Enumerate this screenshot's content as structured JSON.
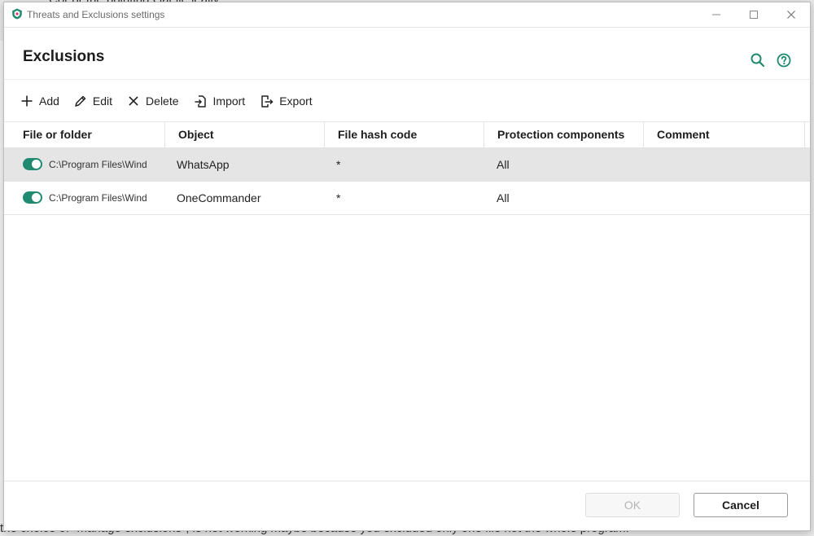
{
  "background": {
    "top_text": "Cor or the pointing Gaelle leally",
    "bottom_text": "the choice of \"manage exclusions\", is not working maybe because you excluded only one file not the whole program."
  },
  "window": {
    "title": "Threats and Exclusions settings",
    "app_icon": "kaspersky-shield-icon"
  },
  "page": {
    "heading": "Exclusions"
  },
  "toolbar": {
    "add_label": "Add",
    "edit_label": "Edit",
    "delete_label": "Delete",
    "import_label": "Import",
    "export_label": "Export"
  },
  "table": {
    "columns": [
      "File or folder",
      "Object",
      "File hash code",
      "Protection components",
      "Comment"
    ],
    "rows": [
      {
        "enabled": true,
        "path": "C:\\Program Files\\Windo",
        "object": "WhatsApp",
        "hash": "*",
        "components": "All",
        "comment": ""
      },
      {
        "enabled": true,
        "path": "C:\\Program Files\\Windo",
        "object": "OneCommander",
        "hash": "*",
        "components": "All",
        "comment": ""
      }
    ]
  },
  "footer": {
    "ok_label": "OK",
    "cancel_label": "Cancel"
  },
  "colors": {
    "accent": "#1f8a6f",
    "selected_row": "#e5e5e5"
  }
}
